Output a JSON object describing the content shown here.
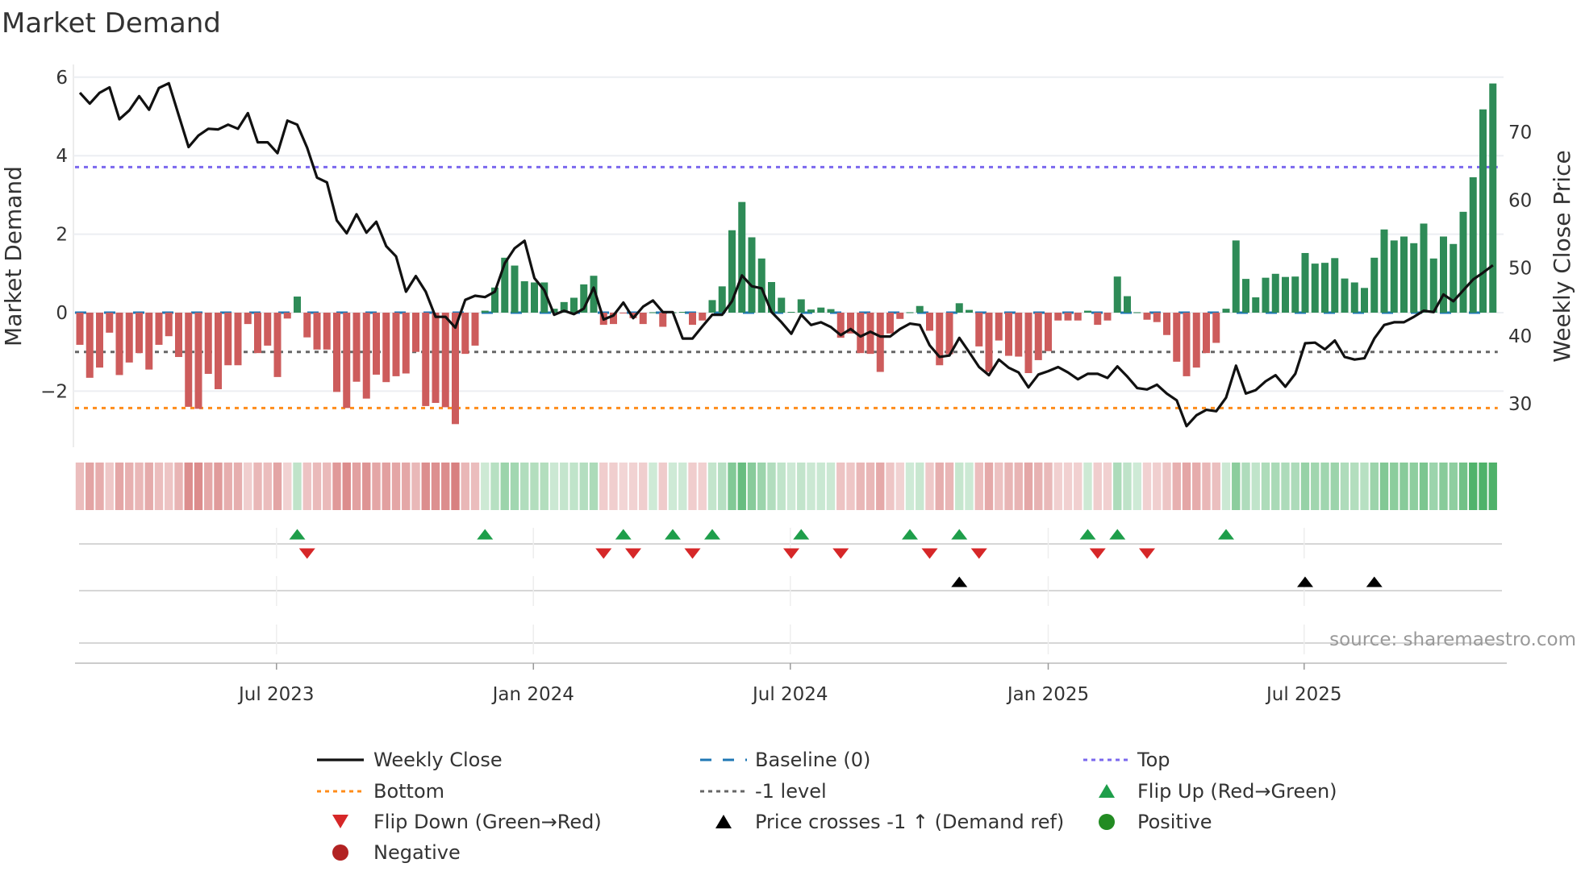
{
  "title": "Market Demand",
  "source": "source: sharemaestro.com",
  "chart_data": {
    "type": "bar+line",
    "title": "Market Demand",
    "ylabel_left": "Market Demand",
    "ylabel_right": "Weekly Close Price",
    "ylim_left": [
      -3.4,
      6.3
    ],
    "yticks_left": [
      {
        "v": 6,
        "label": "6"
      },
      {
        "v": 4,
        "label": "4"
      },
      {
        "v": 2,
        "label": "2"
      },
      {
        "v": 0,
        "label": "0"
      },
      {
        "v": -2,
        "label": "−2"
      }
    ],
    "yticks_right": [
      {
        "v": 70,
        "label": "70"
      },
      {
        "v": 60,
        "label": "60"
      },
      {
        "v": 50,
        "label": "50"
      },
      {
        "v": 40,
        "label": "40"
      },
      {
        "v": 30,
        "label": "30"
      }
    ],
    "x_ticks": [
      {
        "label": "Jul 2023",
        "week_index": 19.9
      },
      {
        "label": "Jan 2024",
        "week_index": 45.9
      },
      {
        "label": "Jul 2024",
        "week_index": 71.9
      },
      {
        "label": "Jan 2025",
        "week_index": 98.0
      },
      {
        "label": "Jul 2025",
        "week_index": 123.9
      }
    ],
    "levels": {
      "baseline": 0,
      "top": 3.71,
      "bottom": -2.43,
      "minus_one": -1
    },
    "demand": [
      -0.82,
      -1.66,
      -1.4,
      -0.51,
      -1.59,
      -1.27,
      -1.03,
      -1.45,
      -0.82,
      -0.6,
      -1.13,
      -2.4,
      -2.45,
      -1.56,
      -1.95,
      -1.34,
      -1.34,
      -0.29,
      -1.03,
      -0.84,
      -1.64,
      -0.15,
      0.41,
      -0.63,
      -0.94,
      -0.94,
      -2.02,
      -2.43,
      -1.76,
      -2.19,
      -1.58,
      -1.77,
      -1.62,
      -1.55,
      -1.0,
      -2.38,
      -2.3,
      -2.41,
      -2.84,
      -1.05,
      -0.84,
      0.05,
      0.64,
      1.4,
      1.2,
      0.8,
      0.77,
      0.77,
      0.1,
      0.27,
      0.38,
      0.72,
      0.94,
      -0.31,
      -0.29,
      -0.02,
      -0.14,
      -0.29,
      0.01,
      -0.36,
      0.01,
      0.02,
      -0.31,
      -0.2,
      0.32,
      0.67,
      2.1,
      2.82,
      1.92,
      1.38,
      0.78,
      0.38,
      0.02,
      0.34,
      0.08,
      0.13,
      0.09,
      -0.64,
      -0.53,
      -1.03,
      -1.05,
      -1.51,
      -0.53,
      -0.16,
      0.01,
      0.17,
      -0.46,
      -1.34,
      -1.06,
      0.24,
      0.07,
      -0.86,
      -1.51,
      -0.71,
      -1.1,
      -1.12,
      -1.54,
      -1.21,
      -0.98,
      -0.2,
      -0.2,
      -0.2,
      0.05,
      -0.31,
      -0.2,
      0.92,
      0.42,
      0.01,
      -0.18,
      -0.24,
      -0.57,
      -1.25,
      -1.62,
      -1.4,
      -1.03,
      -0.77,
      0.1,
      1.84,
      0.86,
      0.39,
      0.89,
      0.99,
      0.91,
      0.92,
      1.52,
      1.25,
      1.27,
      1.39,
      0.87,
      0.77,
      0.63,
      1.4,
      2.12,
      1.84,
      1.94,
      1.77,
      2.27,
      1.38,
      1.94,
      1.75,
      2.57,
      3.45,
      5.18,
      5.84
    ],
    "weekly_close": [
      75.8,
      74.2,
      75.8,
      76.6,
      71.9,
      73.2,
      75.3,
      73.3,
      76.5,
      77.2,
      72.5,
      67.8,
      69.5,
      70.5,
      70.4,
      71.1,
      70.5,
      72.8,
      68.5,
      68.5,
      66.9,
      71.7,
      71.1,
      67.7,
      63.3,
      62.6,
      57.0,
      55.1,
      57.9,
      55.2,
      56.8,
      53.2,
      51.7,
      46.5,
      48.8,
      46.5,
      42.8,
      42.8,
      41.2,
      45.3,
      45.9,
      45.7,
      46.5,
      50.7,
      52.9,
      54.0,
      48.5,
      46.7,
      43.1,
      43.7,
      43.2,
      44.0,
      47.1,
      42.4,
      43.0,
      44.9,
      42.6,
      44.3,
      45.2,
      43.5,
      43.5,
      39.6,
      39.6,
      41.4,
      43.1,
      43.1,
      45.1,
      48.9,
      47.3,
      47.0,
      43.5,
      42.0,
      40.3,
      43.1,
      41.6,
      42.0,
      41.3,
      40.1,
      41.0,
      39.9,
      40.6,
      39.9,
      39.9,
      41.0,
      41.8,
      41.6,
      38.6,
      36.9,
      37.1,
      39.7,
      37.6,
      35.4,
      34.2,
      36.5,
      35.3,
      34.6,
      32.4,
      34.3,
      34.8,
      35.4,
      34.6,
      33.6,
      34.4,
      34.4,
      33.8,
      35.5,
      34.0,
      32.3,
      32.1,
      32.8,
      31.5,
      30.5,
      26.7,
      28.3,
      29.1,
      28.9,
      30.9,
      35.6,
      31.5,
      32.0,
      33.3,
      34.2,
      32.5,
      34.4,
      38.9,
      39.0,
      38.0,
      39.3,
      36.9,
      36.5,
      36.7,
      39.6,
      41.6,
      42.0,
      42.0,
      42.8,
      43.7,
      43.5,
      46.1,
      45.1,
      46.7,
      48.3,
      49.3,
      50.4
    ],
    "flip_up_weeks": [
      22,
      41,
      55,
      60,
      64,
      73,
      84,
      89,
      102,
      105,
      116
    ],
    "flip_down_weeks": [
      23,
      53,
      56,
      62,
      72,
      77,
      86,
      91,
      103,
      108
    ],
    "price_cross_weeks": [
      89,
      124,
      131
    ],
    "legend": [
      {
        "label": "Weekly Close",
        "kind": "line",
        "color": "#111111"
      },
      {
        "label": "Baseline (0)",
        "kind": "dash",
        "color": "#1f77b4"
      },
      {
        "label": "Top",
        "kind": "dot",
        "color": "#7b68ee"
      },
      {
        "label": "Bottom",
        "kind": "dot",
        "color": "#ff8c1a"
      },
      {
        "label": "-1 level",
        "kind": "dot",
        "color": "#666666"
      },
      {
        "label": "Flip Up (Red→Green)",
        "kind": "tri-up",
        "color": "#1e9e4a"
      },
      {
        "label": "Flip Down (Green→Red)",
        "kind": "tri-down",
        "color": "#d62728"
      },
      {
        "label": "Price crosses -1 ↑ (Demand ref)",
        "kind": "tri-up",
        "color": "#000000"
      },
      {
        "label": "Positive",
        "kind": "dot-marker",
        "color": "#228b22"
      },
      {
        "label": "Negative",
        "kind": "dot-marker",
        "color": "#b22222"
      }
    ],
    "colors": {
      "pos_bar": "#2e8b57",
      "neg_bar": "#cd5c5c",
      "grid": "#eceef2"
    }
  }
}
